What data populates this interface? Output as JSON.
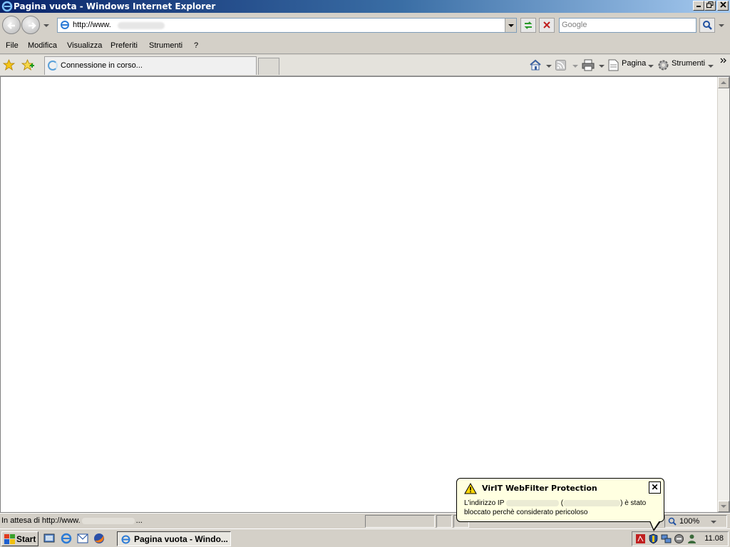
{
  "window": {
    "title": "Pagina vuota - Windows Internet Explorer"
  },
  "address": {
    "url": "http://www."
  },
  "search": {
    "placeholder": "Google"
  },
  "menu": [
    "File",
    "Modifica",
    "Visualizza",
    "Preferiti",
    "Strumenti",
    "?"
  ],
  "tab": {
    "label": "Connessione in corso..."
  },
  "commands": {
    "page": "Pagina",
    "tools": "Strumenti"
  },
  "status": {
    "text": "In attesa di http://www.",
    "ellipsis": "...",
    "zoom": "100%"
  },
  "balloon": {
    "title": "VirIT WebFilter Protection",
    "line1_prefix": "L'indirizzo IP",
    "line1_open": "(",
    "line1_suffix": ") è stato",
    "line2": "bloccato perchè considerato pericoloso",
    "close": "✕"
  },
  "taskbar": {
    "start": "Start",
    "task": "Pagina vuota - Windo...",
    "clock": "11.08"
  },
  "colors": {
    "titlebar": "#0a246a",
    "balloon": "#ffffe1",
    "chrome": "#d4d0c8"
  }
}
